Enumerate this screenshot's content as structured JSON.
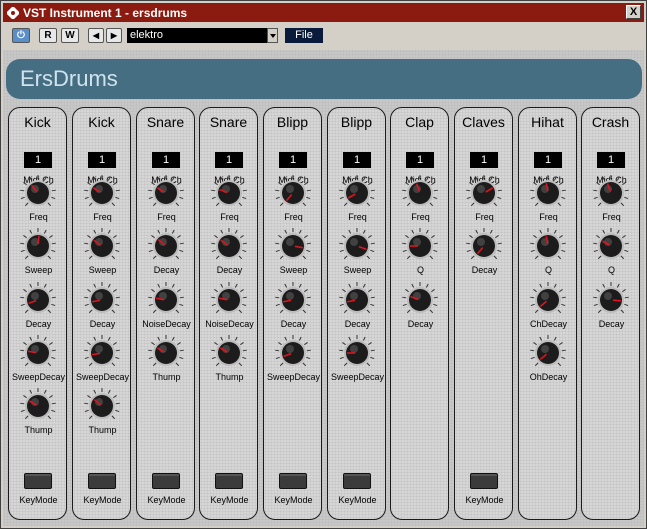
{
  "window": {
    "title": "VST Instrument 1 - ersdrums",
    "close_symbol": "X"
  },
  "toolbar": {
    "power_symbol": "⏻",
    "read_label": "R",
    "write_label": "W",
    "prev_symbol": "◀",
    "next_symbol": "▶",
    "preset_value": "elektro",
    "file_label": "File"
  },
  "header": {
    "title": "ErsDrums"
  },
  "colors": {
    "titlebar": "#8b1a10",
    "header": "#466e82",
    "indicator": "#e0141e"
  },
  "common": {
    "midi_value": "1",
    "midi_label": "Midi Ch",
    "keymode_label": "KeyMode"
  },
  "channels": [
    {
      "name": "Kick",
      "has_keymode": true,
      "knobs": [
        {
          "label": "Freq",
          "angle": -40
        },
        {
          "label": "Sweep",
          "angle": 5
        },
        {
          "label": "Decay",
          "angle": -110
        },
        {
          "label": "SweepDecay",
          "angle": -80
        },
        {
          "label": "Thump",
          "angle": -60
        }
      ]
    },
    {
      "name": "Kick",
      "has_keymode": true,
      "knobs": [
        {
          "label": "Freq",
          "angle": -60
        },
        {
          "label": "Sweep",
          "angle": -55
        },
        {
          "label": "Decay",
          "angle": -100
        },
        {
          "label": "SweepDecay",
          "angle": -100
        },
        {
          "label": "Thump",
          "angle": -50
        }
      ]
    },
    {
      "name": "Snare",
      "has_keymode": true,
      "knobs": [
        {
          "label": "Freq",
          "angle": -60
        },
        {
          "label": "Decay",
          "angle": -50
        },
        {
          "label": "NoiseDecay",
          "angle": -80
        },
        {
          "label": "Thump",
          "angle": -60
        }
      ]
    },
    {
      "name": "Snare",
      "has_keymode": true,
      "knobs": [
        {
          "label": "Freq",
          "angle": -70
        },
        {
          "label": "Decay",
          "angle": -55
        },
        {
          "label": "NoiseDecay",
          "angle": -80
        },
        {
          "label": "Thump",
          "angle": -60
        }
      ]
    },
    {
      "name": "Blipp",
      "has_keymode": true,
      "knobs": [
        {
          "label": "Freq",
          "angle": -140
        },
        {
          "label": "Sweep",
          "angle": 100
        },
        {
          "label": "Decay",
          "angle": -100
        },
        {
          "label": "SweepDecay",
          "angle": -110
        }
      ]
    },
    {
      "name": "Blipp",
      "has_keymode": true,
      "knobs": [
        {
          "label": "Freq",
          "angle": -120
        },
        {
          "label": "Sweep",
          "angle": 110
        },
        {
          "label": "Decay",
          "angle": -100
        },
        {
          "label": "SweepDecay",
          "angle": -90
        }
      ]
    },
    {
      "name": "Clap",
      "has_keymode": false,
      "knobs": [
        {
          "label": "Freq",
          "angle": -20
        },
        {
          "label": "Q",
          "angle": -90
        },
        {
          "label": "Decay",
          "angle": -70
        }
      ]
    },
    {
      "name": "Claves",
      "has_keymode": true,
      "knobs": [
        {
          "label": "Freq",
          "angle": 60
        },
        {
          "label": "Decay",
          "angle": -140
        }
      ]
    },
    {
      "name": "Hihat",
      "has_keymode": false,
      "knobs": [
        {
          "label": "Freq",
          "angle": -10
        },
        {
          "label": "Q",
          "angle": -10
        },
        {
          "label": "ChDecay",
          "angle": -130
        },
        {
          "label": "OhDecay",
          "angle": -130
        }
      ]
    },
    {
      "name": "Crash",
      "has_keymode": false,
      "knobs": [
        {
          "label": "Freq",
          "angle": -20
        },
        {
          "label": "Q",
          "angle": -60
        },
        {
          "label": "Decay",
          "angle": 95
        }
      ]
    }
  ]
}
